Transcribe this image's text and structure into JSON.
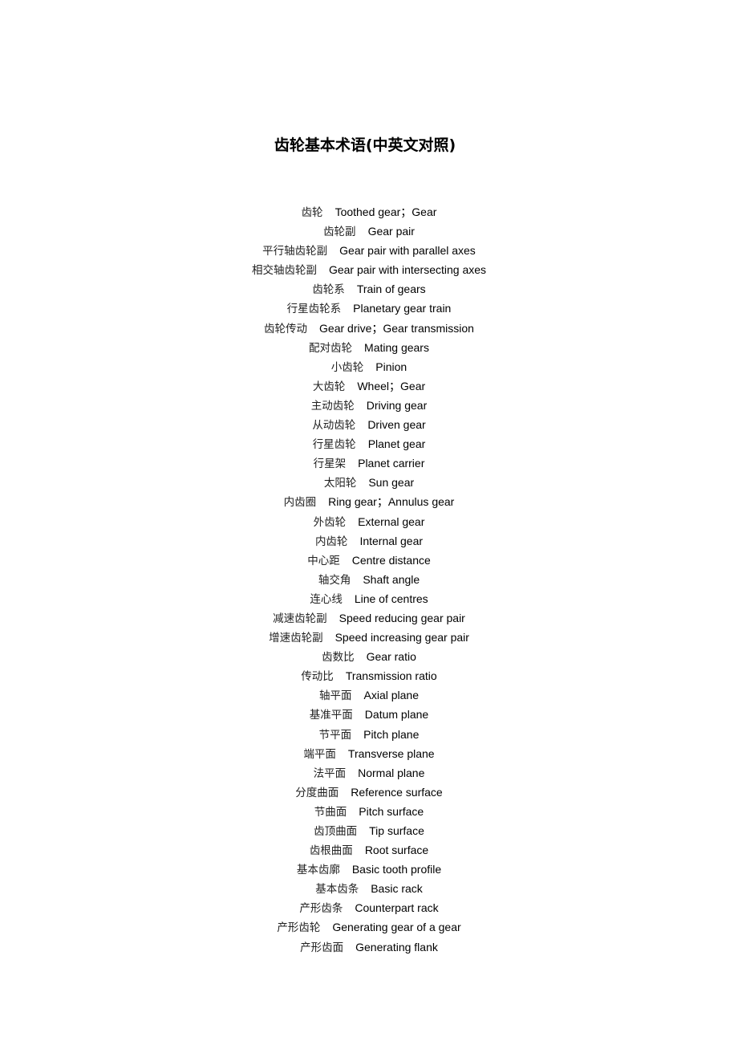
{
  "document": {
    "title": "齿轮基本术语(中英文对照)",
    "terms": [
      {
        "zh": "齿轮",
        "en": "Toothed gear；Gear"
      },
      {
        "zh": "齿轮副",
        "en": "Gear pair"
      },
      {
        "zh": "平行轴齿轮副",
        "en": "Gear pair with parallel axes"
      },
      {
        "zh": "相交轴齿轮副",
        "en": "Gear pair with intersecting axes"
      },
      {
        "zh": "齿轮系",
        "en": "Train of gears"
      },
      {
        "zh": "行星齿轮系",
        "en": "Planetary gear train"
      },
      {
        "zh": "齿轮传动",
        "en": "Gear drive；Gear transmission"
      },
      {
        "zh": "配对齿轮",
        "en": "Mating gears"
      },
      {
        "zh": "小齿轮",
        "en": "Pinion"
      },
      {
        "zh": "大齿轮",
        "en": "Wheel；Gear"
      },
      {
        "zh": "主动齿轮",
        "en": "Driving gear"
      },
      {
        "zh": "从动齿轮",
        "en": "Driven gear"
      },
      {
        "zh": "行星齿轮",
        "en": "Planet gear"
      },
      {
        "zh": "行星架",
        "en": "Planet carrier"
      },
      {
        "zh": "太阳轮",
        "en": "Sun gear"
      },
      {
        "zh": "内齿圈",
        "en": "Ring gear；Annulus gear"
      },
      {
        "zh": "外齿轮",
        "en": "External gear"
      },
      {
        "zh": "内齿轮",
        "en": "Internal gear"
      },
      {
        "zh": "中心距",
        "en": "Centre distance"
      },
      {
        "zh": "轴交角",
        "en": "Shaft angle"
      },
      {
        "zh": "连心线",
        "en": "Line of centres"
      },
      {
        "zh": "减速齿轮副",
        "en": "Speed reducing gear pair"
      },
      {
        "zh": "增速齿轮副",
        "en": "Speed increasing gear pair"
      },
      {
        "zh": "齿数比",
        "en": "Gear ratio"
      },
      {
        "zh": "传动比",
        "en": "Transmission ratio"
      },
      {
        "zh": "轴平面",
        "en": "Axial plane"
      },
      {
        "zh": "基准平面",
        "en": "Datum plane"
      },
      {
        "zh": "节平面",
        "en": "Pitch plane"
      },
      {
        "zh": "端平面",
        "en": "Transverse plane"
      },
      {
        "zh": "法平面",
        "en": "Normal plane"
      },
      {
        "zh": "分度曲面",
        "en": "Reference surface"
      },
      {
        "zh": "节曲面",
        "en": "Pitch surface"
      },
      {
        "zh": "齿顶曲面",
        "en": "Tip surface"
      },
      {
        "zh": "齿根曲面",
        "en": "Root surface"
      },
      {
        "zh": "基本齿廓",
        "en": "Basic tooth profile"
      },
      {
        "zh": "基本齿条",
        "en": "Basic rack"
      },
      {
        "zh": "产形齿条",
        "en": "Counterpart rack"
      },
      {
        "zh": "产形齿轮",
        "en": "Generating gear of a gear"
      },
      {
        "zh": "产形齿面",
        "en": "Generating flank"
      }
    ]
  }
}
